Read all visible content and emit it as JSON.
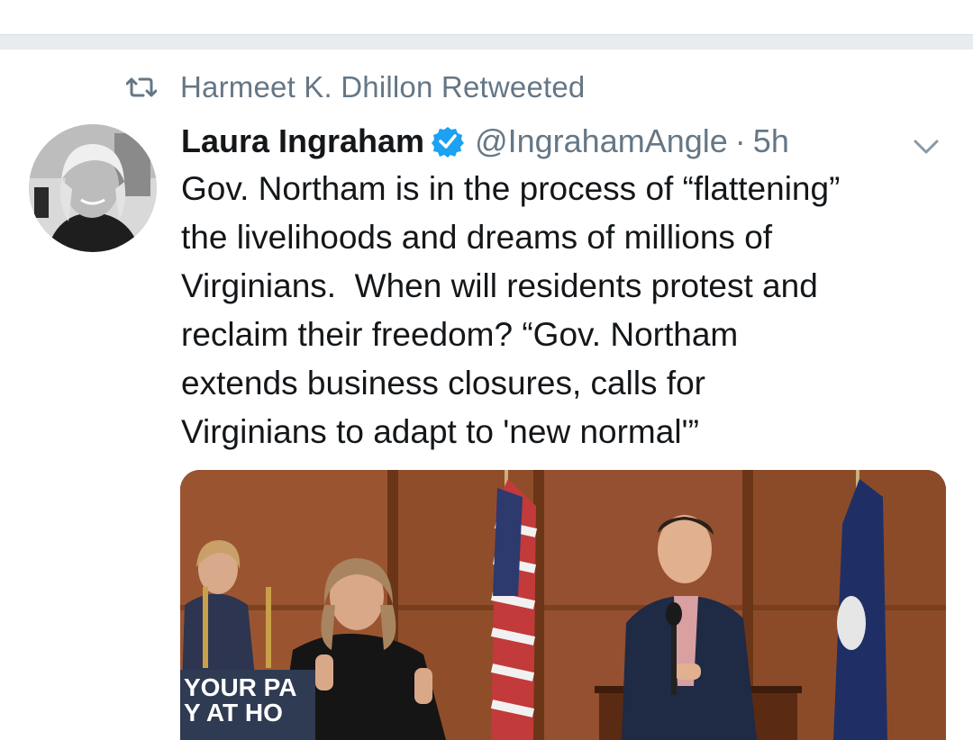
{
  "retweet": {
    "text": "Harmeet K. Dhillon Retweeted",
    "icon": "retweet-icon"
  },
  "tweet": {
    "author_name": "Laura Ingraham",
    "verified": true,
    "handle": "@IngrahamAngle",
    "separator": "·",
    "time": "5h",
    "text": "Gov. Northam is in the process of “flattening”\nthe livelihoods and dreams of millions of\nVirginians.  When will residents protest and\nreclaim their freedom? “Gov. Northam\nextends business closures, calls for\nVirginians to adapt to 'new normal'”",
    "media": {
      "banner_text": "YOUR PA\nY AT HO"
    }
  },
  "colors": {
    "accent": "#1da1f2",
    "secondary_text": "#657786",
    "divider": "#e6ecf0"
  }
}
